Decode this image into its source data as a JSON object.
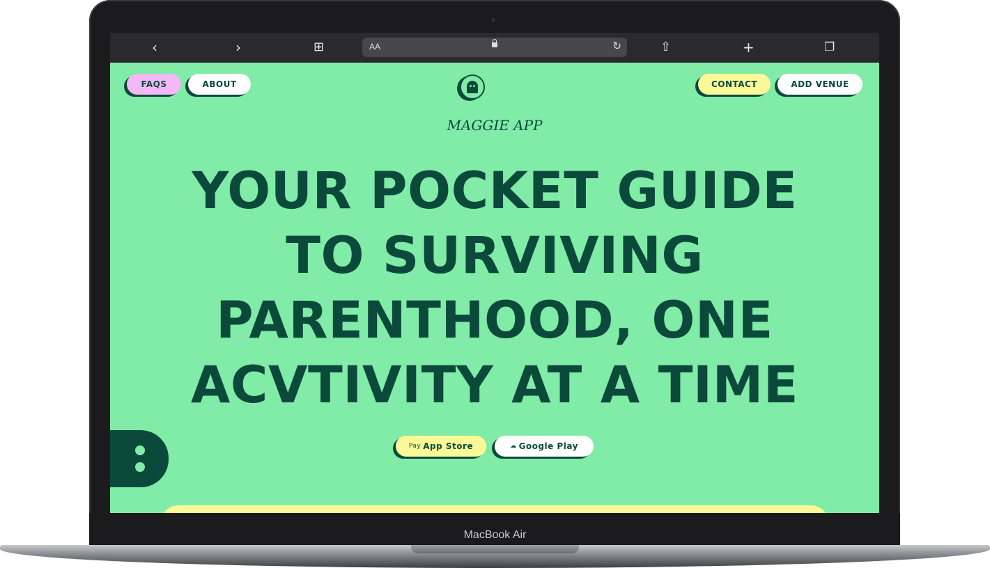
{
  "device": {
    "label": "MacBook Air"
  },
  "browser": {
    "address_text_size": "AA",
    "icons": [
      "back-icon",
      "forward-icon",
      "bookmarks-icon",
      "lock-icon",
      "reload-icon",
      "share-icon",
      "new-tab-icon",
      "tabs-icon"
    ]
  },
  "nav": {
    "faqs": "FAQS",
    "about": "ABOUT",
    "contact": "CONTACT",
    "add_venue": "ADD VENUE"
  },
  "brand": {
    "name": "MAGGIE APP",
    "logo_icon": "ghost-icon"
  },
  "hero": {
    "headline_lines": [
      "YOUR POCKET GUIDE",
      "TO SURVIVING",
      "PARENTHOOD, ONE",
      "ACVTIVITY AT A TIME"
    ]
  },
  "stores": {
    "app_store_badge": "Pay",
    "app_store": "App Store",
    "google_play": "Google Play"
  },
  "colors": {
    "background": "#81eba8",
    "primary_text": "#0b4a3b",
    "pink": "#f4b8f4",
    "yellow": "#fbf897",
    "white": "#ffffff"
  }
}
